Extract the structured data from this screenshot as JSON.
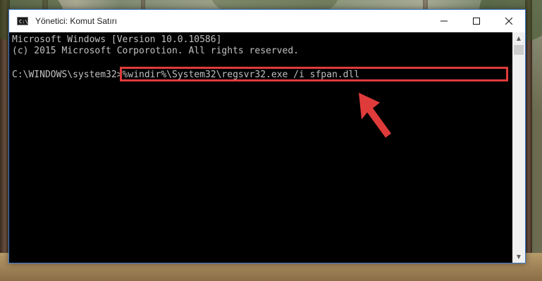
{
  "window": {
    "title": "Yönetici: Komut Satırı",
    "icon": "console-app-icon",
    "icon_label": "C:\\",
    "controls": [
      "minimize-icon",
      "maximize-icon",
      "close-icon"
    ]
  },
  "console": {
    "lines": [
      "Microsoft Windows [Version 10.0.10586]",
      "(c) 2015 Microsoft Corporotion. All rights reserved."
    ],
    "prompt": "C:\\WINDOWS\\system32>",
    "command": "%windir%\\System32\\regsvr32.exe /i sfpan.dll"
  },
  "colors": {
    "console_background": "#000000",
    "console_text": "#c0c0c0",
    "highlight": "#e03b3b",
    "window_border": "#3c7bd6"
  }
}
